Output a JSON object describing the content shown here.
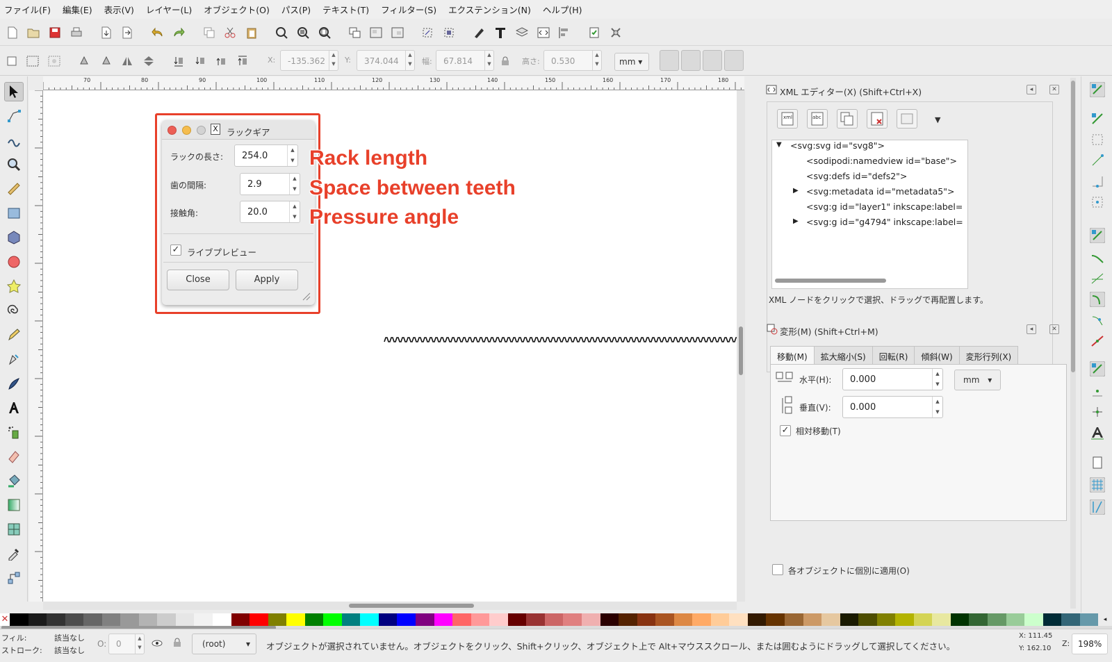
{
  "menubar": [
    "ファイル(F)",
    "編集(E)",
    "表示(V)",
    "レイヤー(L)",
    "オブジェクト(O)",
    "パス(P)",
    "テキスト(T)",
    "フィルター(S)",
    "エクステンション(N)",
    "ヘルプ(H)"
  ],
  "controls": {
    "x_label": "X:",
    "x_value": "-135.362",
    "y_label": "Y:",
    "y_value": "374.044",
    "w_label": "幅:",
    "w_value": "67.814",
    "h_label": "高さ:",
    "h_value": "0.530",
    "unit": "mm"
  },
  "ruler_ticks": [
    "70",
    "80",
    "90",
    "100",
    "110",
    "120",
    "130",
    "140",
    "150",
    "160",
    "170",
    "180"
  ],
  "dialog": {
    "title": "ラックギア",
    "rack_length_label": "ラックの長さ:",
    "rack_length_value": "254.0",
    "teeth_space_label": "歯の間隔:",
    "teeth_space_value": "2.9",
    "pressure_angle_label": "接触角:",
    "pressure_angle_value": "20.0",
    "live_preview_label": "ライブプレビュー",
    "live_preview_checked": true,
    "close_label": "Close",
    "apply_label": "Apply"
  },
  "annotations": [
    "Rack length",
    "Space between teeth",
    "Pressure angle"
  ],
  "xml_editor": {
    "title": "XML エディター(X) (Shift+Ctrl+X)",
    "nodes": [
      "<svg:svg id=\"svg8\">",
      "<sodipodi:namedview id=\"base\">",
      "<svg:defs id=\"defs2\">",
      "<svg:metadata id=\"metadata5\">",
      "<svg:g id=\"layer1\" inkscape:label=",
      "<svg:g id=\"g4794\" inkscape:label="
    ],
    "hint": "XML ノードをクリックで選択、ドラッグで再配置します。"
  },
  "transform": {
    "title": "変形(M) (Shift+Ctrl+M)",
    "tabs": [
      "移動(M)",
      "拡大縮小(S)",
      "回転(R)",
      "傾斜(W)",
      "変形行列(X)"
    ],
    "horizontal_label": "水平(H):",
    "horizontal_value": "0.000",
    "vertical_label": "垂直(V):",
    "vertical_value": "0.000",
    "unit": "mm",
    "relative_label": "相対移動(T)",
    "apply_each_label": "各オブジェクトに個別に適用(O)"
  },
  "status": {
    "fill_label": "フィル:",
    "fill_value": "該当なし",
    "stroke_label": "ストローク:",
    "stroke_value": "該当なし",
    "opacity_label": "O:",
    "opacity_value": "0",
    "layer": "(root)",
    "message": "オブジェクトが選択されていません。オブジェクトをクリック、Shift+クリック、オブジェクト上で Alt+マウススクロール、または囲むようにドラッグして選択してください。",
    "x": "X: 111.45",
    "y": "Y: 162.10",
    "zoom_label": "Z:",
    "zoom": "198%"
  },
  "colors": {
    "accent_red": "#e8402a"
  },
  "palette": [
    "#000000",
    "#1a1a1a",
    "#333333",
    "#4d4d4d",
    "#666666",
    "#808080",
    "#999999",
    "#b3b3b3",
    "#cccccc",
    "#e6e6e6",
    "#f2f2f2",
    "#ffffff",
    "#800000",
    "#ff0000",
    "#808000",
    "#ffff00",
    "#008000",
    "#00ff00",
    "#008080",
    "#00ffff",
    "#000080",
    "#0000ff",
    "#800080",
    "#ff00ff",
    "#ff6666",
    "#ff9999",
    "#ffcccc",
    "#660000",
    "#993333",
    "#cc6666",
    "#e08080",
    "#f0b0b0",
    "#2b0000",
    "#552200",
    "#883311",
    "#aa5522",
    "#dd8844",
    "#ffaa66",
    "#ffcc99",
    "#ffe0c0",
    "#331a00",
    "#663300",
    "#996633",
    "#cc9966",
    "#e6c8a0",
    "#1a1a00",
    "#4d4d00",
    "#808000",
    "#b3b300",
    "#d4d455",
    "#e8e8a0",
    "#003300",
    "#336633",
    "#669966",
    "#99cc99",
    "#ccffcc",
    "#002b36",
    "#336677",
    "#6699aa"
  ]
}
